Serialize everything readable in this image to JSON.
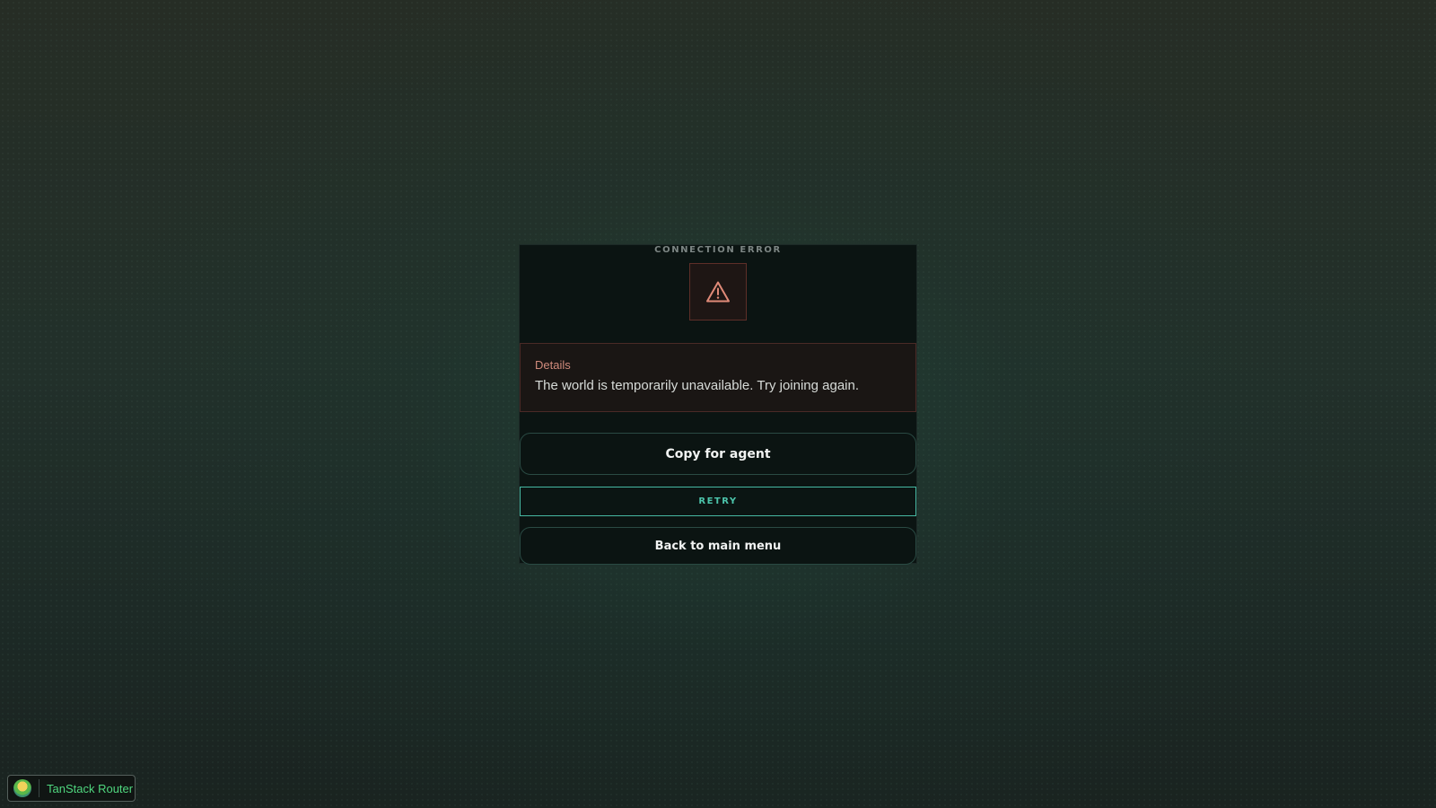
{
  "dialog": {
    "title": "CONNECTION ERROR",
    "icon": "warning-triangle-icon",
    "details_label": "Details",
    "details_message": "The world is temporarily unavailable. Try joining again."
  },
  "actions": {
    "copy_label": "Copy for agent",
    "retry_label": "RETRY",
    "back_label": "Back to main menu"
  },
  "devtools": {
    "label": "TanStack Router",
    "icon": "tanstack-logo-icon"
  },
  "colors": {
    "accent": "#46b8a2",
    "error": "#d87c6c",
    "devtools_text": "#4fd67e"
  }
}
